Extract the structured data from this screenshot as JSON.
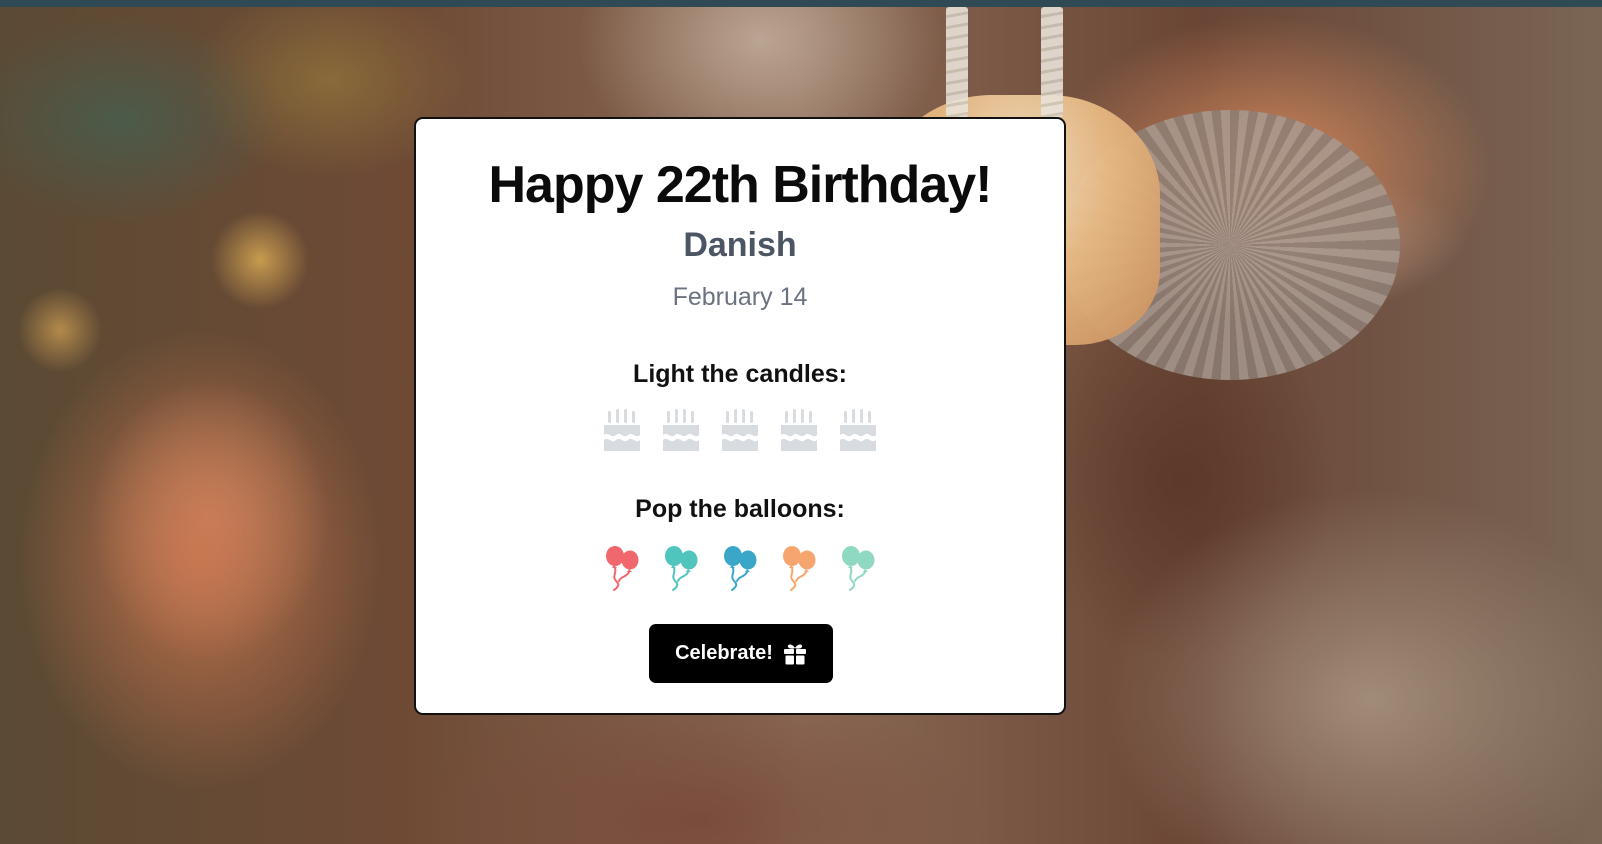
{
  "card": {
    "title": "Happy 22th Birthday!",
    "name": "Danish",
    "date": "February 14",
    "candles_heading": "Light the candles:",
    "balloons_heading": "Pop the balloons:",
    "candles": [
      {
        "icon": "birthday-cake-icon",
        "lit": false
      },
      {
        "icon": "birthday-cake-icon",
        "lit": false
      },
      {
        "icon": "birthday-cake-icon",
        "lit": false
      },
      {
        "icon": "birthday-cake-icon",
        "lit": false
      },
      {
        "icon": "birthday-cake-icon",
        "lit": false
      }
    ],
    "balloons": [
      {
        "icon": "balloons-icon",
        "color": "#f0676e"
      },
      {
        "icon": "balloons-icon",
        "color": "#4fc5bd"
      },
      {
        "icon": "balloons-icon",
        "color": "#3aa7c9"
      },
      {
        "icon": "balloons-icon",
        "color": "#f7a56e"
      },
      {
        "icon": "balloons-icon",
        "color": "#8fd9c2"
      }
    ],
    "celebrate_button": {
      "label": "Celebrate!",
      "icon": "gift-icon"
    }
  },
  "colors": {
    "card_background": "#ffffff",
    "button_background": "#000000",
    "candle_unlit": "#d8dbe0",
    "name_text": "#4b5563",
    "date_text": "#6b7280"
  }
}
